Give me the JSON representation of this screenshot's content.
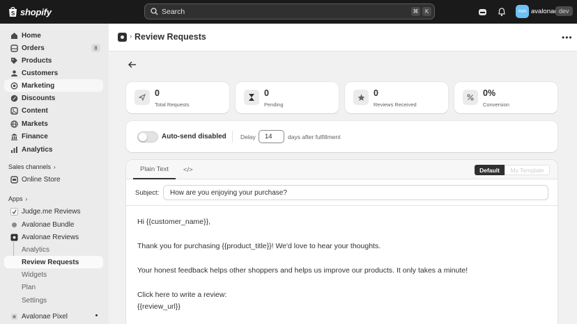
{
  "topbar": {
    "logo_text": "shopify",
    "search_placeholder": "Search",
    "shortcut_keys": [
      "⌘",
      "K"
    ],
    "avatar_initials": "AVA",
    "store_name": "avalonae",
    "store_badge": "dev"
  },
  "sidebar": {
    "items": [
      {
        "label": "Home",
        "icon": "home-icon"
      },
      {
        "label": "Orders",
        "icon": "orders-icon",
        "count": "8"
      },
      {
        "label": "Products",
        "icon": "tag-icon"
      },
      {
        "label": "Customers",
        "icon": "person-icon"
      },
      {
        "label": "Marketing",
        "icon": "target-icon"
      },
      {
        "label": "Discounts",
        "icon": "discount-icon"
      },
      {
        "label": "Content",
        "icon": "content-icon"
      },
      {
        "label": "Markets",
        "icon": "globe-icon"
      },
      {
        "label": "Finance",
        "icon": "bank-icon"
      },
      {
        "label": "Analytics",
        "icon": "chart-icon"
      }
    ],
    "sales_channels_label": "Sales channels",
    "online_store": "Online Store",
    "apps_label": "Apps",
    "apps": [
      {
        "label": "Judge.me Reviews"
      },
      {
        "label": "Avalonae Bundle"
      },
      {
        "label": "Avalonae Reviews"
      }
    ],
    "app_subitems": [
      "Analytics",
      "Review Requests",
      "Widgets",
      "Plan",
      "Settings"
    ],
    "pixel_app": "Avalonae Pixel"
  },
  "header": {
    "title": "Review Requests"
  },
  "stats": [
    {
      "value": "0",
      "label": "Total Requests",
      "icon": "send-icon"
    },
    {
      "value": "0",
      "label": "Pending",
      "icon": "hourglass-icon"
    },
    {
      "value": "0",
      "label": "Reviews Received",
      "icon": "star-icon"
    },
    {
      "value": "0%",
      "label": "Conversion",
      "icon": "percent-icon"
    }
  ],
  "settings": {
    "auto_send_label": "Auto-send disabled",
    "delay_label": "Delay",
    "delay_value": "14",
    "delay_suffix": "days after fulfillment"
  },
  "editor": {
    "tabs": [
      "Plain Text",
      "</>"
    ],
    "template_default": "Default",
    "template_mine": "My Template",
    "subject_label": "Subject:",
    "subject_value": "How are you enjoying your purchase?",
    "body_lines": [
      "Hi {{customer_name}},",
      "Thank you for purchasing {{product_title}}! We'd love to hear your thoughts.",
      "Your honest feedback helps other shoppers and helps us improve our products. It only takes a minute!",
      "Click here to write a review:",
      "{{review_url}}"
    ]
  }
}
